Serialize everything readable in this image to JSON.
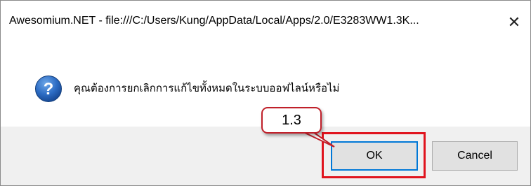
{
  "dialog": {
    "title": "Awesomium.NET - file:///C:/Users/Kung/AppData/Local/Apps/2.0/E3283WW1.3K...",
    "close_label": "✕",
    "message": "คุณต้องการยกเลิกการแก้ไขทั้งหมดในระบบออฟไลน์หรือไม่",
    "icon": "question-icon"
  },
  "buttons": {
    "ok_label": "OK",
    "cancel_label": "Cancel"
  },
  "annotation": {
    "callout_label": "1.3",
    "highlight_color": "#e0141e"
  },
  "colors": {
    "accent": "#0078d7",
    "footer_bg": "#f0f0f0"
  }
}
